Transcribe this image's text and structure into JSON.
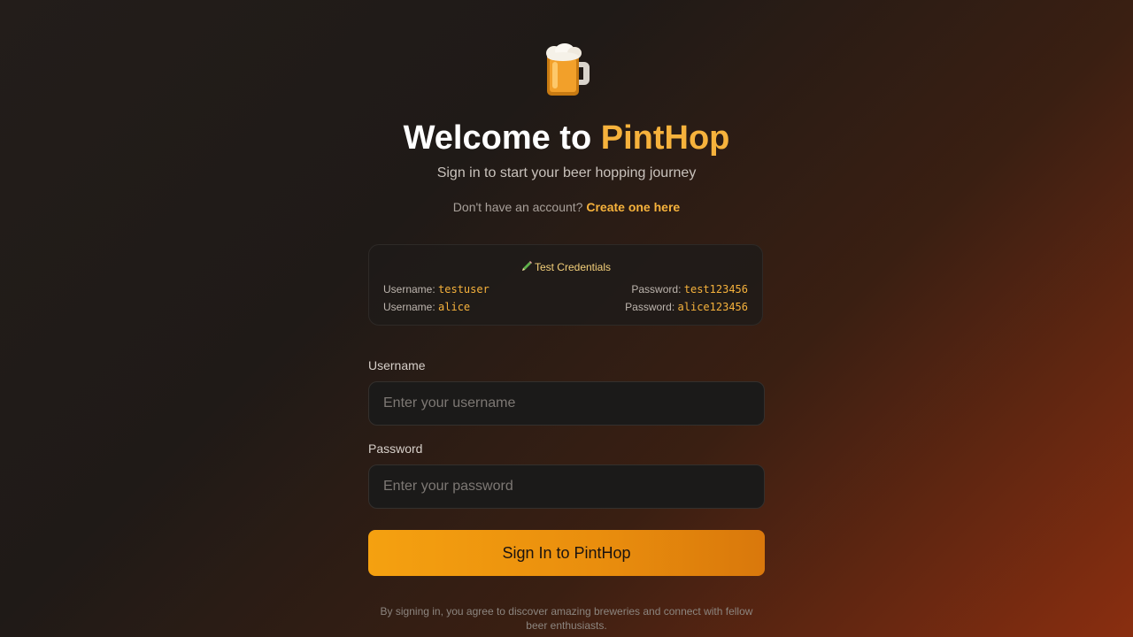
{
  "header": {
    "logo_icon": "beer-mug-icon",
    "title_prefix": "Welcome to ",
    "title_brand": "PintHop",
    "subtitle": "Sign in to start your beer hopping journey",
    "signup_prompt": "Don't have an account?",
    "signup_link": "Create one here"
  },
  "test_credentials": {
    "icon": "pencil-icon",
    "title": "Test Credentials",
    "username_label": "Username:",
    "password_label": "Password:",
    "accounts": [
      {
        "username": "testuser",
        "password": "test123456"
      },
      {
        "username": "alice",
        "password": "alice123456"
      }
    ]
  },
  "form": {
    "username_label": "Username",
    "username_placeholder": "Enter your username",
    "username_value": "",
    "password_label": "Password",
    "password_placeholder": "Enter your password",
    "password_value": "",
    "submit_label": "Sign In to PintHop"
  },
  "footer": {
    "text": "By signing in, you agree to discover amazing breweries and connect with fellow beer enthusiasts."
  },
  "colors": {
    "accent": "#f6b23c",
    "button": "#f5a110",
    "background": "#231d1a"
  }
}
